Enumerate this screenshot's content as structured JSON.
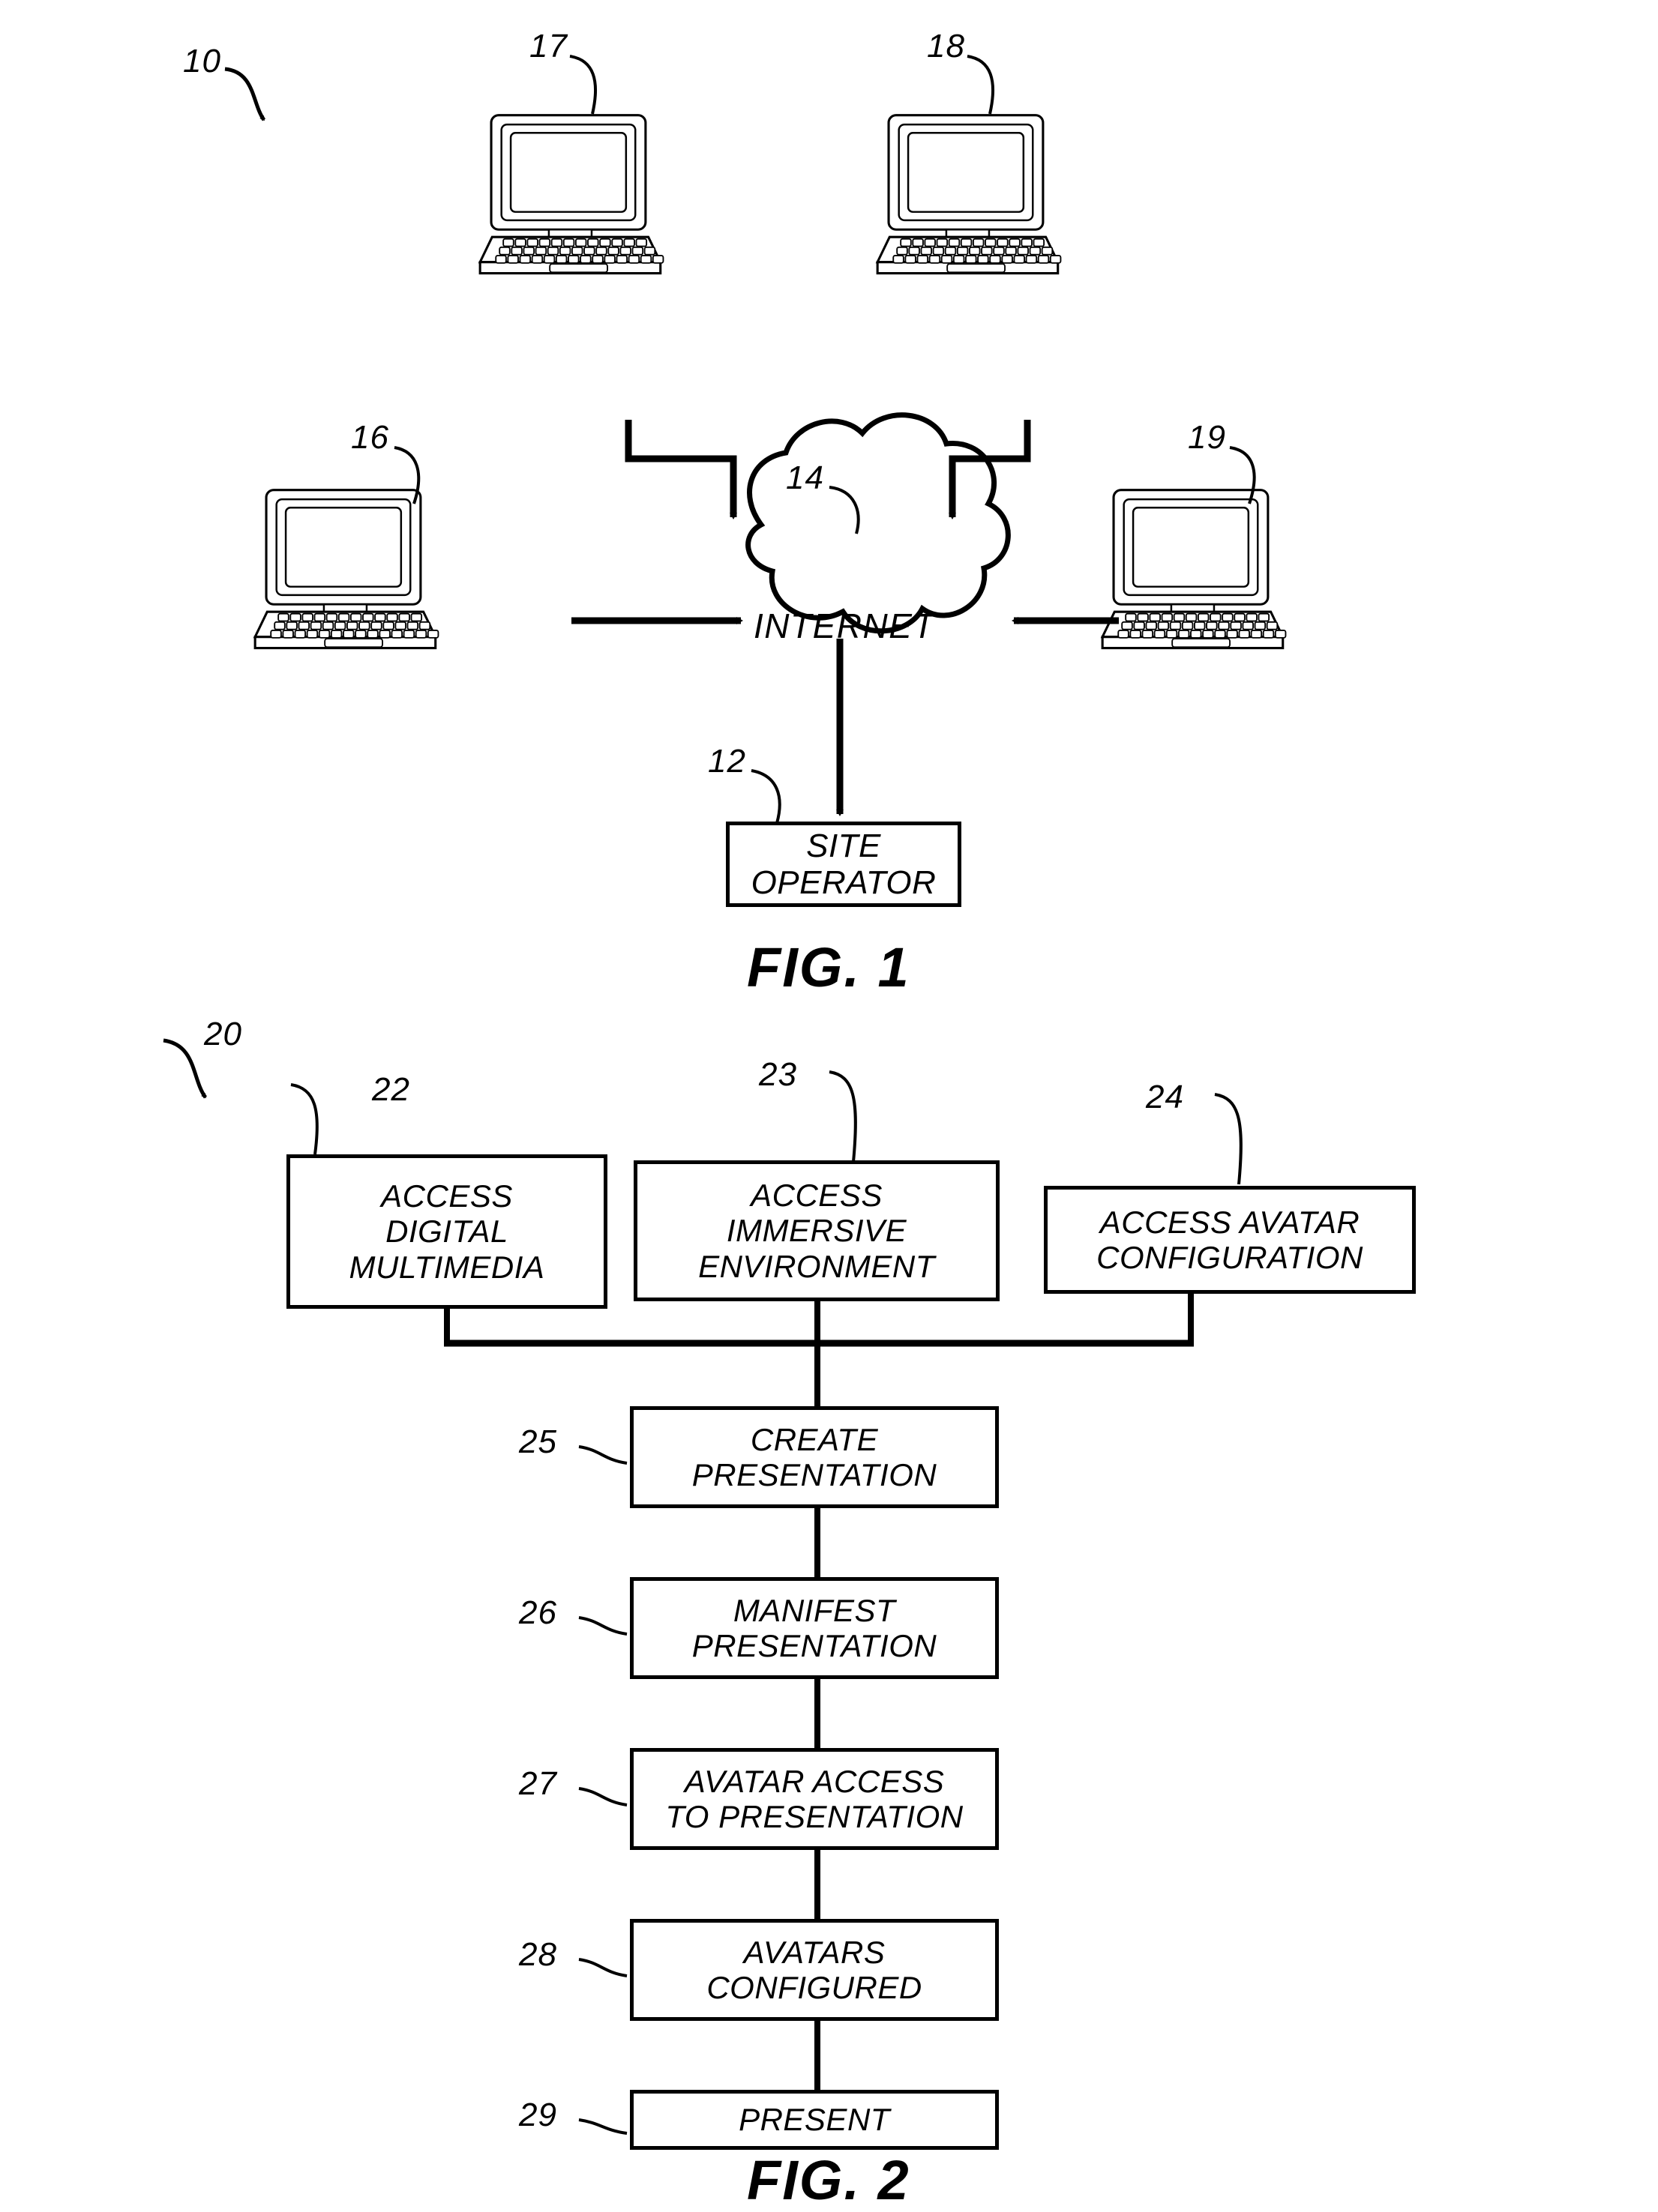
{
  "figure1": {
    "reference": "10",
    "caption": "FIG. 1",
    "cloud": {
      "label": "INTERNET",
      "reference": "14"
    },
    "site_operator": {
      "label": "SITE\nOPERATOR",
      "reference": "12"
    },
    "computers": [
      {
        "reference": "16",
        "position": "left"
      },
      {
        "reference": "17",
        "position": "top-left"
      },
      {
        "reference": "18",
        "position": "top-right"
      },
      {
        "reference": "19",
        "position": "right"
      }
    ]
  },
  "figure2": {
    "reference": "20",
    "caption": "FIG. 2",
    "top_boxes": [
      {
        "reference": "22",
        "label": "ACCESS\nDIGITAL\nMULTIMEDIA"
      },
      {
        "reference": "23",
        "label": "ACCESS\nIMMERSIVE\nENVIRONMENT"
      },
      {
        "reference": "24",
        "label": "ACCESS AVATAR\nCONFIGURATION"
      }
    ],
    "steps": [
      {
        "reference": "25",
        "label": "CREATE\nPRESENTATION"
      },
      {
        "reference": "26",
        "label": "MANIFEST\nPRESENTATION"
      },
      {
        "reference": "27",
        "label": "AVATAR ACCESS\nTO PRESENTATION"
      },
      {
        "reference": "28",
        "label": "AVATARS\nCONFIGURED"
      },
      {
        "reference": "29",
        "label": "PRESENT"
      }
    ]
  },
  "colors": {
    "ink": "#000000",
    "paper": "#ffffff"
  }
}
